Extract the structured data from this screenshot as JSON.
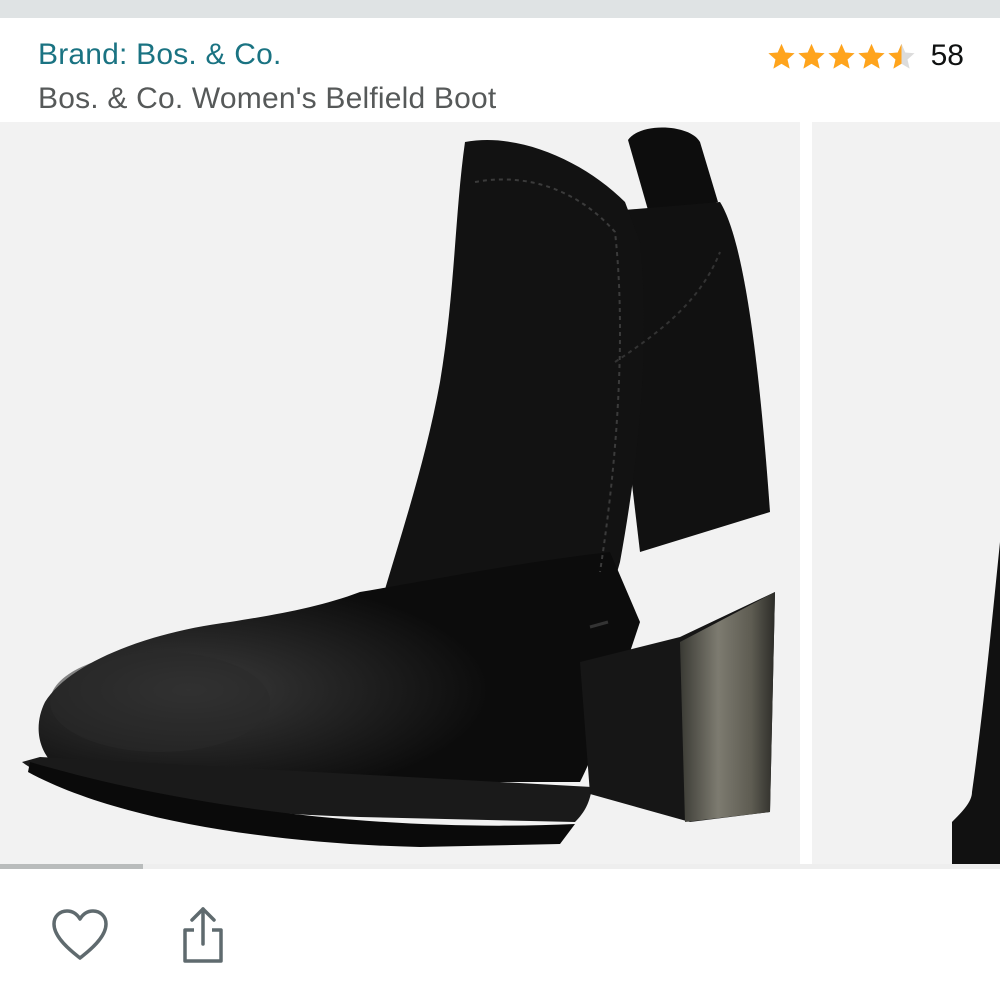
{
  "header": {
    "brand_link": "Brand: Bos. & Co.",
    "product_title": "Bos. & Co. Women's Belfield Boot",
    "rating": {
      "stars": 4.5,
      "max_stars": 5,
      "count": "58",
      "star_color": "#ffa41c",
      "empty_star_color": "#dcdcdc"
    }
  },
  "gallery": {
    "main_image": "black-suede-ankle-boot",
    "next_image": "black-suede-ankle-boot-partial",
    "current_index_fraction": 0.143
  },
  "actions": {
    "wishlist_icon": "heart-outline-icon",
    "share_icon": "share-icon"
  },
  "colors": {
    "brand_link": "#1a7382",
    "title": "#565959",
    "image_bg": "#f2f2f2",
    "top_strip": "#dfe3e4"
  }
}
